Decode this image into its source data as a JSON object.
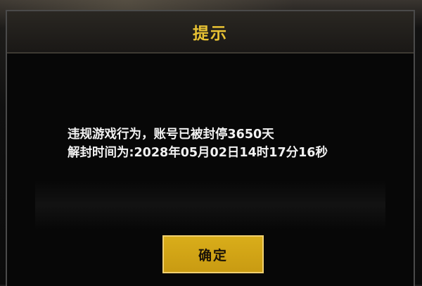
{
  "dialog": {
    "title": "提示",
    "message_line1": "违规游戏行为，账号已被封停3650天",
    "message_line2": "解封时间为:2028年05月02日14时17分16秒",
    "confirm_label": "确定"
  },
  "colors": {
    "title": "#e8c233",
    "button_fill": "#d9ad1a",
    "dialog_bg": "#070707",
    "text": "#f2f2f2"
  }
}
